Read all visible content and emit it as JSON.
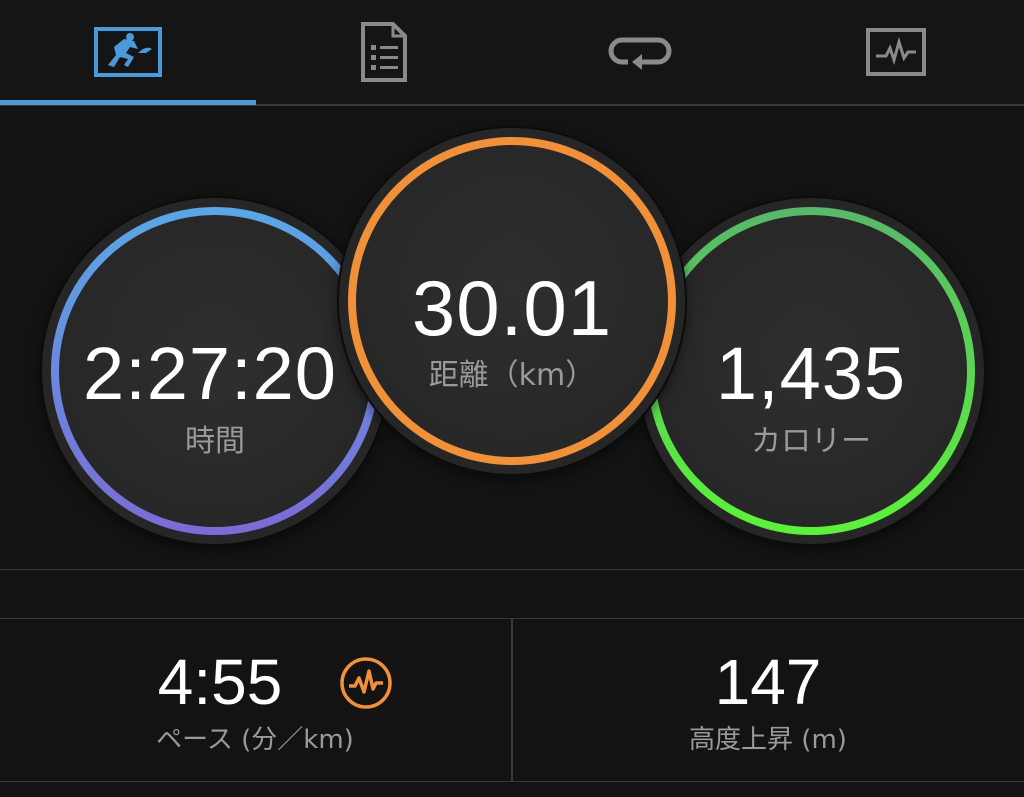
{
  "tabs": [
    {
      "name": "overview",
      "icon": "running-figure-icon",
      "active": true
    },
    {
      "name": "details",
      "icon": "document-list-icon",
      "active": false
    },
    {
      "name": "laps",
      "icon": "loop-arrow-icon",
      "active": false
    },
    {
      "name": "charts",
      "icon": "chart-monitor-icon",
      "active": false
    }
  ],
  "rings": {
    "time": {
      "value": "2:27:20",
      "label": "時間",
      "colors": [
        "#5aa7e6",
        "#7b6bd6"
      ]
    },
    "distance": {
      "value": "30.01",
      "label": "距離（km）",
      "colors": [
        "#f0913a",
        "#f0913a"
      ]
    },
    "calories": {
      "value": "1,435",
      "label": "カロリー",
      "colors": [
        "#58b86a",
        "#5cf23a"
      ]
    }
  },
  "stats": {
    "pace": {
      "value": "4:55",
      "label": "ペース (分／km)",
      "icon": "pace-graph-icon",
      "icon_color": "#f0913a"
    },
    "elevation": {
      "value": "147",
      "label": "高度上昇 (m)"
    }
  },
  "colors": {
    "active_tab": "#4a9ad9",
    "inactive_icon": "#8a8a8a"
  }
}
